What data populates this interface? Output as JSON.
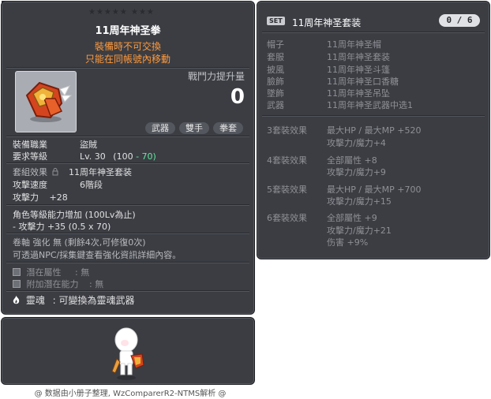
{
  "item_id": "01472241",
  "item": {
    "stars_row": "★★★★★  ★★★",
    "name": "11周年神圣拳",
    "warnings": [
      "裝備時不可交換",
      "只能在同帳號內移動"
    ],
    "power_label": "戰鬥力提升量",
    "power_value": "0",
    "tags": [
      "武器",
      "雙手",
      "拳套"
    ],
    "job_label": "裝備職業",
    "job_value": "盜賊",
    "level_label": "要求等級",
    "level_value": "Lv. 30",
    "level_breakdown_open": "(100",
    "level_breakdown_bonus": "- 70)",
    "set_label": "套組效果",
    "set_value": "11周年神圣套装",
    "speed_label": "攻擊速度",
    "speed_value": "6階段",
    "attack_label": "攻擊力",
    "attack_value": "+28",
    "level_bonus_title": "角色等級能力增加 (100Lv為止)",
    "level_bonus_line": "- 攻擊力 +35 (0.5 x 70)",
    "scroll_line": "卷軸 強化 無 (剩餘4次,可修復0次)",
    "npc_line": "可透過NPC/採集鍵查看強化資訊詳細內容。",
    "potential_label": "潛在屬性",
    "potential_value": ": 無",
    "bonus_potential_label": "附加潛在能力",
    "bonus_potential_value": ": 無",
    "soul_label": "靈魂",
    "soul_value": ": 可變換為靈魂武器"
  },
  "set": {
    "badge": "SET",
    "name": "11周年神圣套装",
    "count": "0 / 6",
    "pieces": [
      {
        "slot": "帽子",
        "name": "11周年神圣帽"
      },
      {
        "slot": "套服",
        "name": "11周年神圣套装"
      },
      {
        "slot": "披風",
        "name": "11周年神圣斗篷"
      },
      {
        "slot": "臉飾",
        "name": "11周年神圣口香糖"
      },
      {
        "slot": "墜飾",
        "name": "11周年神圣吊坠"
      },
      {
        "slot": "武器",
        "name": "11周年神圣武器中选1"
      }
    ],
    "effects": [
      {
        "label": "3套裝效果",
        "lines": [
          "最大HP / 最大MP  +520",
          "攻擊力/魔力+4"
        ]
      },
      {
        "label": "4套裝效果",
        "lines": [
          "全部屬性 +8",
          "攻擊力/魔力+9"
        ]
      },
      {
        "label": "5套裝效果",
        "lines": [
          "最大HP / 最大MP  +700",
          "攻擊力/魔力+15"
        ]
      },
      {
        "label": "6套裝效果",
        "lines": [
          "全部屬性 +9",
          "攻擊力/魔力+21",
          "伤害 +9%"
        ]
      }
    ]
  },
  "footer": "@ 数据由小册子整理, WzComparerR2-NTMS解析 @",
  "colors": {
    "panel": "#3b3d43",
    "warn": "#ff9a3c",
    "green": "#64e6a0"
  },
  "icons": [
    "lock-icon",
    "potential-icon",
    "flame-icon",
    "weapon-icon",
    "character-icon"
  ]
}
